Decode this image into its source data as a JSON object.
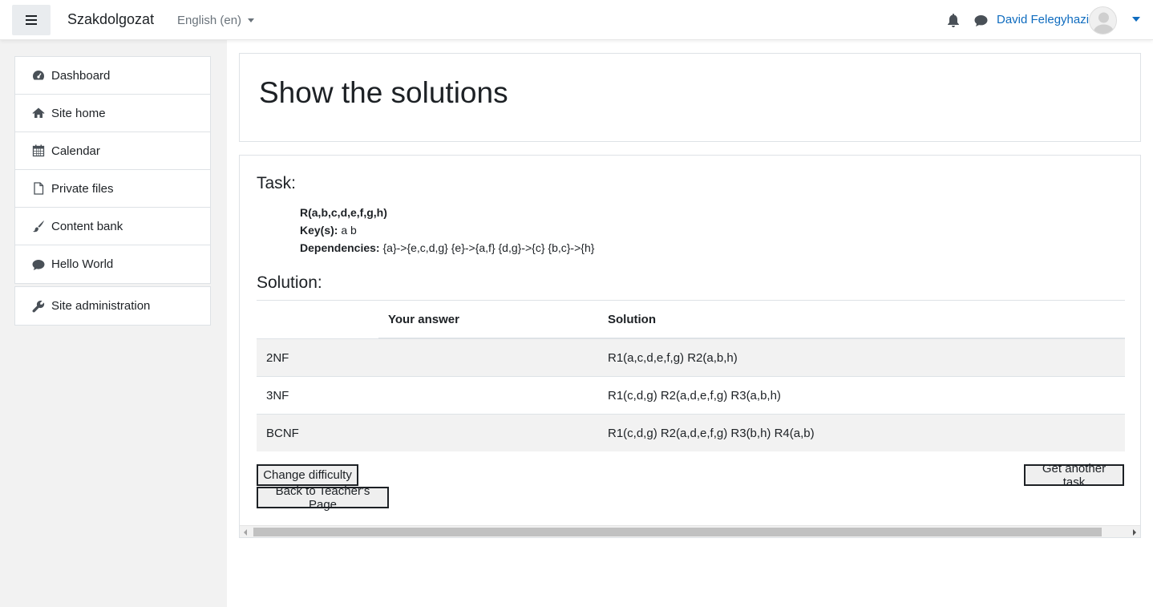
{
  "navbar": {
    "site_name": "Szakdolgozat",
    "language": "English (en)",
    "user_name": "David Felegyhazi"
  },
  "sidebar": {
    "items": [
      {
        "label": "Dashboard",
        "icon": "dashboard-icon"
      },
      {
        "label": "Site home",
        "icon": "home-icon"
      },
      {
        "label": "Calendar",
        "icon": "calendar-icon"
      },
      {
        "label": "Private files",
        "icon": "file-icon"
      },
      {
        "label": "Content bank",
        "icon": "brush-icon"
      },
      {
        "label": "Hello World",
        "icon": "comment-icon"
      }
    ],
    "admin": {
      "label": "Site administration",
      "icon": "wrench-icon"
    }
  },
  "header": {
    "title": "Show the solutions"
  },
  "task": {
    "heading": "Task:",
    "relation": "R(a,b,c,d,e,f,g,h)",
    "keys_label": "Key(s):",
    "keys_value": "a b",
    "deps_label": "Dependencies:",
    "deps_value": "{a}->{e,c,d,g} {e}->{a,f} {d,g}->{c} {b,c}->{h}"
  },
  "solution": {
    "heading": "Solution:",
    "columns": [
      "",
      "Your answer",
      "Solution"
    ],
    "rows": [
      {
        "form": "2NF",
        "answer": "",
        "solution": "R1(a,c,d,e,f,g) R2(a,b,h)"
      },
      {
        "form": "3NF",
        "answer": "",
        "solution": "R1(c,d,g) R2(a,d,e,f,g) R3(a,b,h)"
      },
      {
        "form": "BCNF",
        "answer": "",
        "solution": "R1(c,d,g) R2(a,d,e,f,g) R3(b,h) R4(a,b)"
      }
    ]
  },
  "buttons": {
    "change_difficulty": "Change difficulty",
    "get_another_task": "Get another task",
    "back": "Back to Teacher's Page"
  },
  "colors": {
    "link": "#0f6cbf",
    "drawer_bg": "#f2f2f2",
    "stripe": "#f2f2f2"
  }
}
